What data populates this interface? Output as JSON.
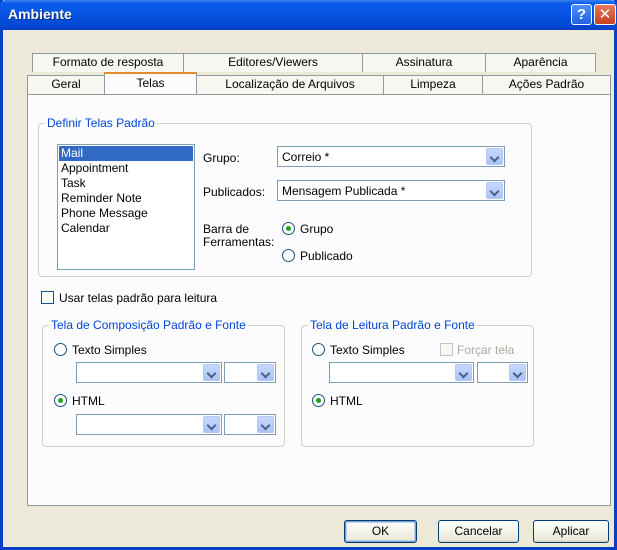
{
  "window": {
    "title": "Ambiente",
    "help_glyph": "?",
    "close_glyph": "✕"
  },
  "tabs_back": [
    "Formato de resposta",
    "Editores/Viewers",
    "Assinatura",
    "Aparência"
  ],
  "tabs_front": [
    "Geral",
    "Telas",
    "Localização de Arquivos",
    "Limpeza",
    "Ações Padrão"
  ],
  "active_tab": "Telas",
  "default_screens": {
    "legend": "Definir Telas Padrão",
    "list": [
      "Mail",
      "Appointment",
      "Task",
      "Reminder Note",
      "Phone Message",
      "Calendar"
    ],
    "selected": "Mail",
    "group_label": "Grupo:",
    "group_value": "Correio *",
    "published_label": "Publicados:",
    "published_value": "Mensagem Publicada *",
    "toolbar_label_line1": "Barra de",
    "toolbar_label_line2": "Ferramentas:",
    "radio_group": "Grupo",
    "radio_published": "Publicado",
    "toolbar_selected": "Grupo"
  },
  "use_default_reading": {
    "label": "Usar telas padrão para leitura",
    "checked": false
  },
  "compose": {
    "legend": "Tela de Composição Padrão e Fonte",
    "plain_text": "Texto Simples",
    "html": "HTML",
    "selected": "HTML"
  },
  "reading": {
    "legend": "Tela de Leitura Padrão e Fonte",
    "plain_text": "Texto Simples",
    "force_screen": "Forçar tela",
    "html": "HTML",
    "selected": "HTML"
  },
  "buttons": {
    "ok": "OK",
    "cancel": "Cancelar",
    "apply": "Aplicar"
  }
}
